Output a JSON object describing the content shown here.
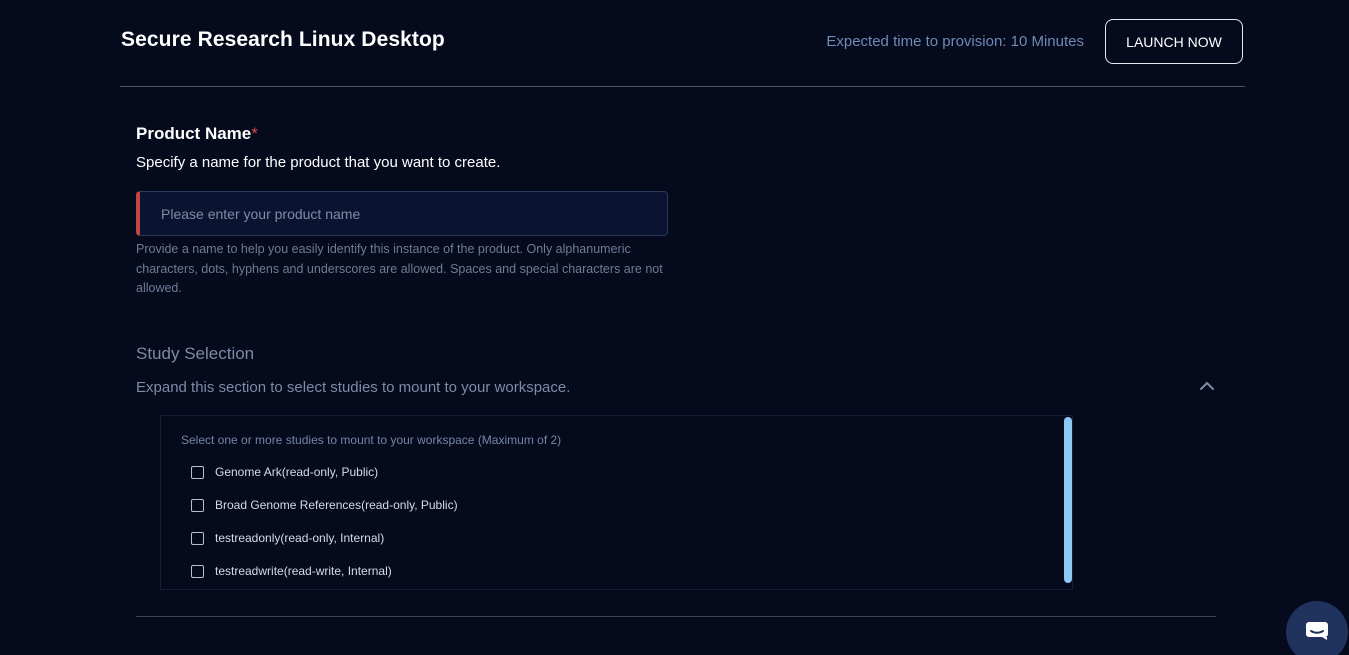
{
  "header": {
    "title": "Secure Research Linux Desktop",
    "eta": "Expected time to provision: 10 Minutes",
    "launch_label": "LAUNCH NOW"
  },
  "product_name": {
    "label": "Product Name",
    "required_mark": "*",
    "subtitle": "Specify a name for the product that you want to create.",
    "value": "",
    "placeholder": "Please enter your product name",
    "help": "Provide a name to help you easily identify this instance of the product. Only alphanumeric characters, dots, hyphens and underscores are allowed. Spaces and special characters are not allowed."
  },
  "study_selection": {
    "title": "Study Selection",
    "subtitle": "Expand this section to select studies to mount to your workspace.",
    "expanded": true,
    "instructions": "Select one or more studies to mount to your workspace (Maximum of 2)",
    "studies": [
      {
        "label": "Genome Ark(read-only, Public)",
        "checked": false
      },
      {
        "label": "Broad Genome References(read-only, Public)",
        "checked": false
      },
      {
        "label": "testreadonly(read-only, Internal)",
        "checked": false
      },
      {
        "label": "testreadwrite(read-write, Internal)",
        "checked": false
      }
    ]
  },
  "colors": {
    "background": "#050a1c",
    "required": "#d94a4a",
    "input_error_border": "#c24444",
    "scrollbar": "#8cc8f2",
    "chat_button": "#20335e"
  },
  "icons": {
    "collapse": "chevron-up-icon",
    "chat": "chat-bubble-icon"
  }
}
